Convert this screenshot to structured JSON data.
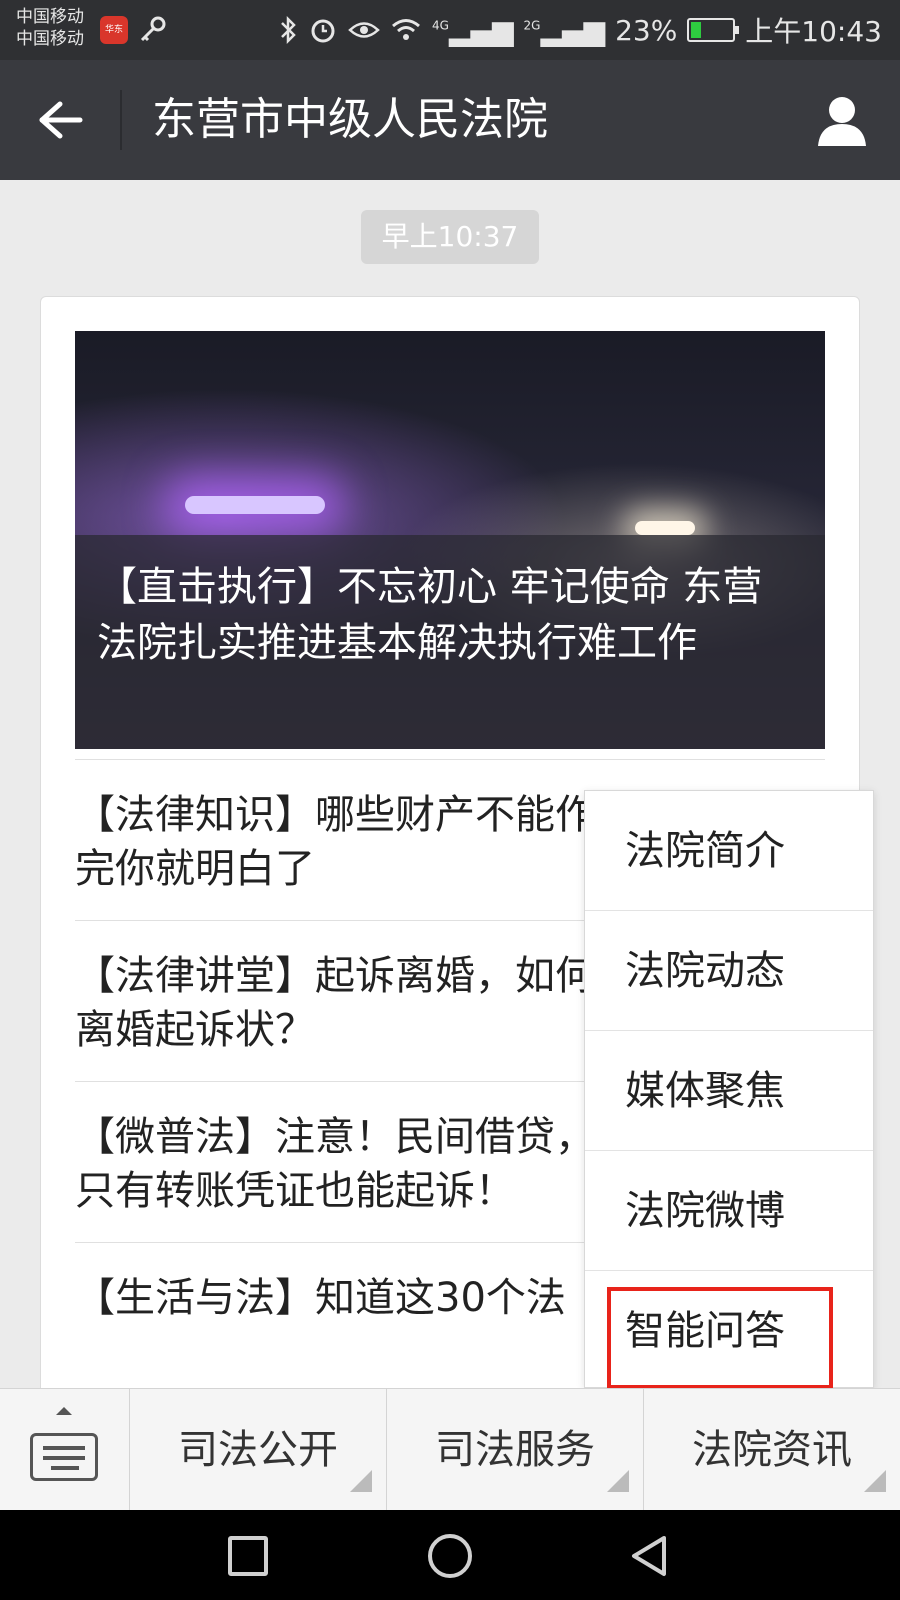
{
  "status_bar": {
    "carrier_1": "中国移动",
    "carrier_2": "中国移动",
    "app_badge_text": "华东",
    "net_1": "4G",
    "net_2": "2G",
    "battery_percent": "23%",
    "battery_level": 0.23,
    "time": "上午10:43"
  },
  "header": {
    "title": "东营市中级人民法院",
    "back_icon": "arrow-left-icon",
    "profile_icon": "person-icon"
  },
  "chat": {
    "timestamp": "早上10:37",
    "cover_title": "【直击执行】不忘初心 牢记使命 东营法院扎实推进基本解决执行难工作",
    "articles": [
      "【法律知识】哪些财产不能作为遗产？看完你就明白了",
      "【法律讲堂】起诉离婚，如何写好有效的离婚起诉状？",
      "【微普法】注意！民间借贷，没有借条，只有转账凭证也能起诉！",
      "【生活与法】知道这30个法"
    ]
  },
  "menu": {
    "items": [
      "法院简介",
      "法院动态",
      "媒体聚焦",
      "法院微博",
      "智能问答"
    ],
    "highlight_color": "#e8231a"
  },
  "bottom_bar": {
    "keyboard_icon": "keyboard-icon",
    "tabs": [
      "司法公开",
      "司法服务",
      "法院资讯"
    ]
  },
  "nav_bar": {
    "icons": [
      "recent-apps-icon",
      "home-icon",
      "back-triangle-icon"
    ]
  }
}
